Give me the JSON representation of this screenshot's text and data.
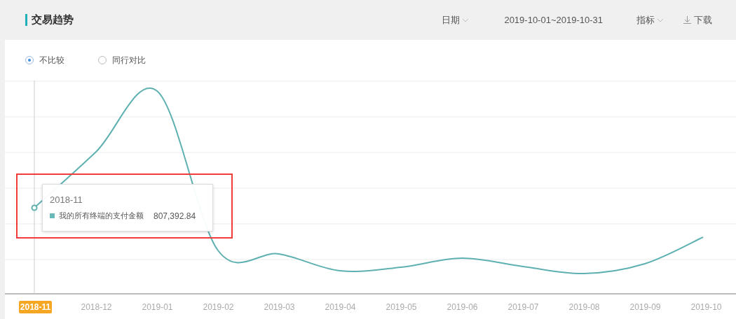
{
  "header": {
    "title": "交易趋势",
    "date_filter": {
      "label": "日期"
    },
    "date_range": "2019-10-01~2019-10-31",
    "metric_filter": {
      "label": "指标"
    },
    "download": {
      "label": "下载"
    }
  },
  "compare_options": [
    {
      "label": "不比较",
      "selected": true
    },
    {
      "label": "同行对比",
      "selected": false
    }
  ],
  "chart": {
    "x_labels": [
      {
        "label": "2018-11",
        "selected": true
      },
      {
        "label": "2018-12",
        "selected": false
      },
      {
        "label": "2019-01",
        "selected": false
      },
      {
        "label": "2019-02",
        "selected": false
      },
      {
        "label": "2019-03",
        "selected": false
      },
      {
        "label": "2019-04",
        "selected": false
      },
      {
        "label": "2019-05",
        "selected": false
      },
      {
        "label": "2019-06",
        "selected": false
      },
      {
        "label": "2019-07",
        "selected": false
      },
      {
        "label": "2019-08",
        "selected": false
      },
      {
        "label": "2019-09",
        "selected": false
      },
      {
        "label": "2019-10",
        "selected": false
      }
    ],
    "tooltip": {
      "title": "2018-11",
      "series_name": "我的所有终端的支付金额",
      "value": "807,392.84",
      "color": "#6ab8b8"
    }
  }
}
